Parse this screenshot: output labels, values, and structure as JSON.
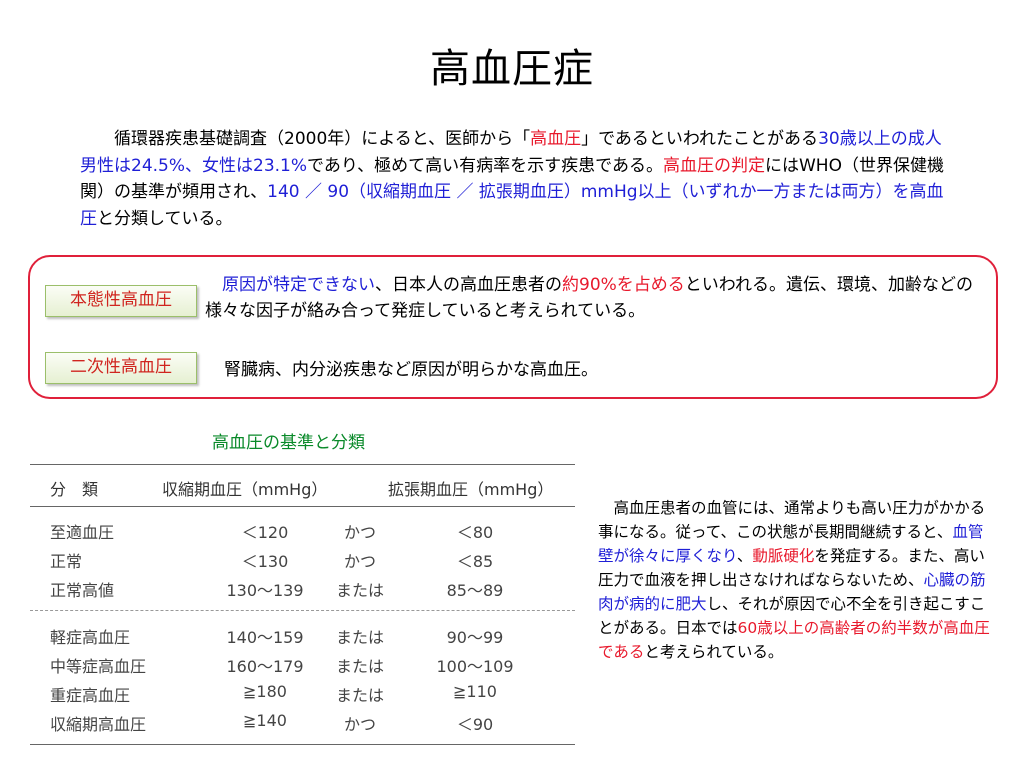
{
  "title": "高血圧症",
  "intro": {
    "p1": "循環器疾患基礎調査（2000年）によると、医師から「",
    "p1_red": "高血圧",
    "p2": "」であるといわれたことがある",
    "p2_blue": "30歳以上の成人男性は24.5%、女性は23.1%",
    "p3": "であり、極めて高い有病率を示す疾患である。",
    "p3_red": "高血圧の判定",
    "p4": "にはWHO（世界保健機関）の基準が頻用され、",
    "p4_blue": "140 ／ 90（収縮期血圧 ／ 拡張期血圧）mmHg以上（いずれか一方または両方）を高血圧",
    "p5": "と分類している。"
  },
  "types": {
    "essential": {
      "label": "本態性高血圧",
      "d_blue": "原因が特定できない",
      "d1": "、日本人の高血圧患者の",
      "d_red": "約90%を占める",
      "d2": "といわれる。遺伝、環境、加齢などの様々な因子が絡み合って発症していると考えられている。"
    },
    "secondary": {
      "label": "二次性高血圧",
      "desc": "腎臓病、内分泌疾患など原因が明らかな高血圧。"
    }
  },
  "table": {
    "title": "高血圧の基準と分類",
    "headers": [
      "分　類",
      "収縮期血圧（mmHg）",
      "拡張期血圧（mmHg）"
    ],
    "rows": [
      [
        "至適血圧",
        "＜120",
        "かつ",
        "＜80"
      ],
      [
        "正常",
        "＜130",
        "かつ",
        "＜85"
      ],
      [
        "正常高値",
        "130～139",
        "または",
        "85～89"
      ],
      [
        "軽症高血圧",
        "140～159",
        "または",
        "90～99"
      ],
      [
        "中等症高血圧",
        "160～179",
        "または",
        "100～109"
      ],
      [
        "重症高血圧",
        "≧180",
        "または",
        "≧110"
      ],
      [
        "収縮期高血圧",
        "≧140",
        "かつ",
        "＜90"
      ]
    ]
  },
  "side": {
    "s1": "高血圧患者の血管には、通常よりも高い圧力がかかる事になる。従って、この状態が長期間継続すると、",
    "s1_blue": "血管壁が徐々に厚くなり",
    "s2": "、",
    "s2_red": "動脈硬化",
    "s3": "を発症する。また、高い圧力で血液を押し出さなければならないため、",
    "s3_blue": "心臓の筋肉が病的に肥大",
    "s4": "し、それが原因で心不全を引き起こすことがある。日本では",
    "s4_red": "60歳以上の高齢者の約半数が高血圧である",
    "s5": "と考えられている。"
  },
  "colors": {
    "red": "#e8192c",
    "blue": "#1f1fd6",
    "green": "#0a8a2a",
    "box_border": "#e0203a"
  }
}
